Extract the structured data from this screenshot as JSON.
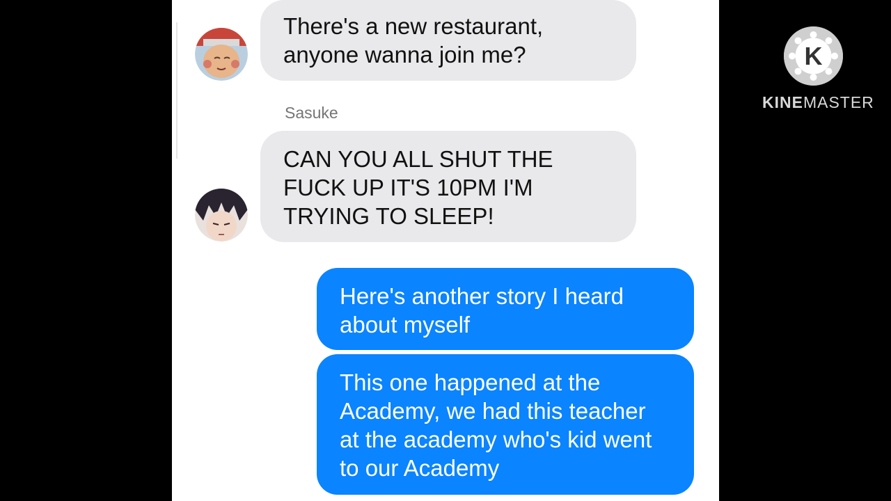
{
  "messages": [
    {
      "text_lines": [
        "There's a new restaurant,",
        "anyone wanna join me?"
      ]
    },
    {
      "sender": "Sasuke",
      "text_lines": [
        "CAN YOU ALL SHUT THE",
        "FUCK UP IT'S 10PM I'M",
        "TRYING TO SLEEP!"
      ]
    },
    {
      "text_lines": [
        "Here's another story I heard",
        "about myself"
      ]
    },
    {
      "text_lines": [
        "This one happened at the",
        "Academy, we had this teacher",
        "at the academy who's kid went",
        "to our Academy"
      ]
    }
  ],
  "watermark": {
    "brand_bold": "KINE",
    "brand_regular": "MASTER",
    "logo_letter": "K"
  },
  "colors": {
    "incoming_bubble": "#e9e9eb",
    "outgoing_bubble": "#0a84ff",
    "background": "#000000"
  }
}
